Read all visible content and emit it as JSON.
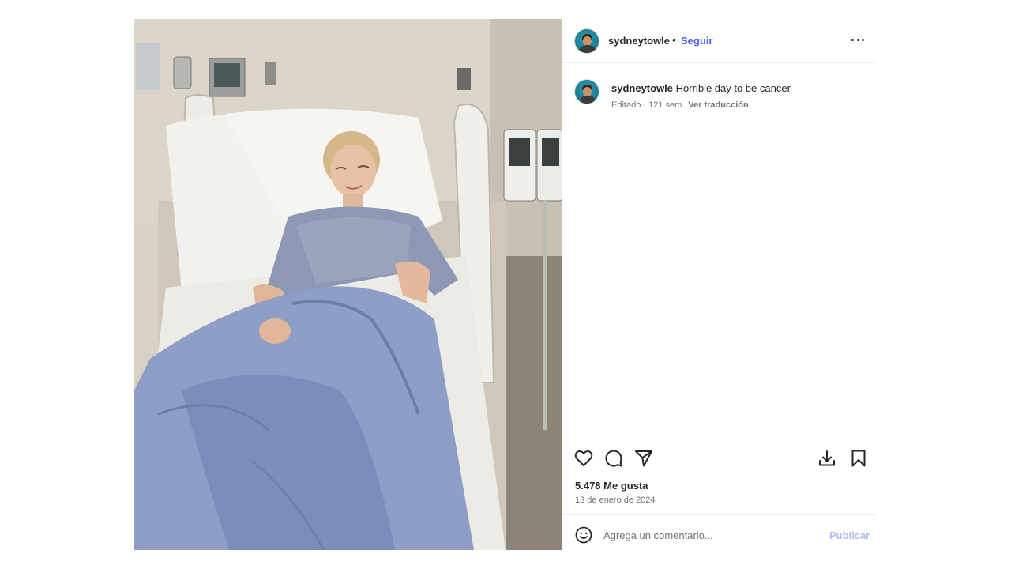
{
  "post": {
    "author": {
      "username": "sydneytowle",
      "avatar_icon": "profile-avatar"
    },
    "header": {
      "separator": "•",
      "follow_label": "Seguir",
      "more_icon": "more-horizontal-icon"
    },
    "caption": {
      "username": "sydneytowle",
      "text": "Horrible day to be cancer",
      "meta": "Editado · 121 sem",
      "translate_label": "Ver traducción"
    },
    "actions": {
      "like_icon": "heart-icon",
      "comment_icon": "comment-icon",
      "share_icon": "share-icon",
      "download_icon": "download-icon",
      "save_icon": "bookmark-icon"
    },
    "likes_label": "5.478 Me gusta",
    "date": "13 de enero de 2024",
    "comment": {
      "emoji_icon": "emoji-icon",
      "placeholder": "Agrega un comentario...",
      "publish_label": "Publicar"
    }
  },
  "colors": {
    "link_blue": "#4a5df9",
    "publish_disabled": "#b3bcfa",
    "secondary_text": "#737373",
    "divider": "#efefef"
  }
}
